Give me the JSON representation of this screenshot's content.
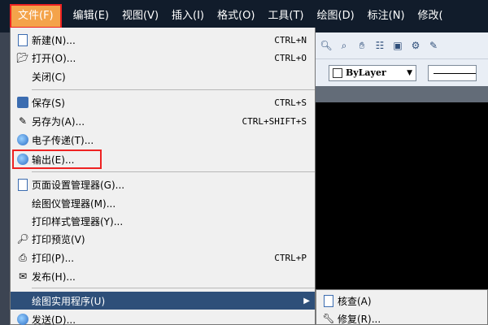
{
  "menubar": {
    "items": [
      "文件(F)",
      "编辑(E)",
      "视图(V)",
      "插入(I)",
      "格式(O)",
      "工具(T)",
      "绘图(D)",
      "标注(N)",
      "修改("
    ]
  },
  "toolbar": {
    "icons": [
      "zoom-window-icon",
      "zoom-previous-icon",
      "pan-icon",
      "properties-icon",
      "design-center-icon",
      "tool-palette-icon",
      "markup-icon"
    ]
  },
  "properties": {
    "layer_value": "ByLayer"
  },
  "file_menu": {
    "items": [
      {
        "label": "新建(N)...",
        "shortcut": "CTRL+N",
        "icon": "new-file-icon"
      },
      {
        "label": "打开(O)...",
        "shortcut": "CTRL+O",
        "icon": "open-folder-icon"
      },
      {
        "label": "关闭(C)",
        "shortcut": "",
        "icon": ""
      },
      {
        "label": "保存(S)",
        "shortcut": "CTRL+S",
        "icon": "save-icon"
      },
      {
        "label": "另存为(A)...",
        "shortcut": "CTRL+SHIFT+S",
        "icon": "save-as-icon"
      },
      {
        "label": "电子传递(T)...",
        "shortcut": "",
        "icon": "etransmit-icon"
      },
      {
        "label": "输出(E)...",
        "shortcut": "",
        "icon": "export-icon"
      },
      {
        "label": "页面设置管理器(G)...",
        "shortcut": "",
        "icon": "page-setup-icon"
      },
      {
        "label": "绘图仪管理器(M)...",
        "shortcut": "",
        "icon": ""
      },
      {
        "label": "打印样式管理器(Y)...",
        "shortcut": "",
        "icon": ""
      },
      {
        "label": "打印预览(V)",
        "shortcut": "",
        "icon": "print-preview-icon"
      },
      {
        "label": "打印(P)...",
        "shortcut": "CTRL+P",
        "icon": "print-icon"
      },
      {
        "label": "发布(H)...",
        "shortcut": "",
        "icon": "publish-icon"
      },
      {
        "label": "绘图实用程序(U)",
        "shortcut": "",
        "icon": ""
      },
      {
        "label": "发送(D)...",
        "shortcut": "",
        "icon": "send-icon"
      }
    ]
  },
  "submenu": {
    "items": [
      {
        "label": "核查(A)",
        "icon": "audit-icon"
      },
      {
        "label": "修复(R)...",
        "icon": "recover-icon"
      }
    ]
  }
}
